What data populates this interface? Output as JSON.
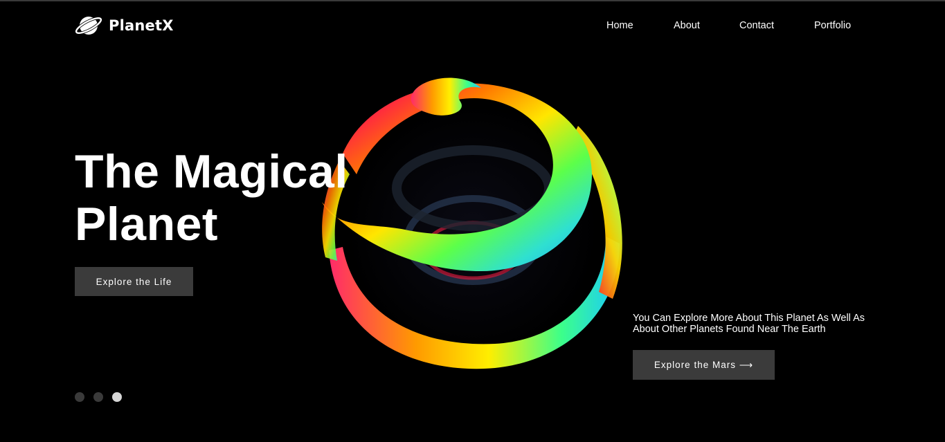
{
  "brand": {
    "name": "PlanetX",
    "logo_icon": "planet-ring-icon"
  },
  "nav": {
    "items": [
      {
        "label": "Home"
      },
      {
        "label": "About"
      },
      {
        "label": "Contact"
      },
      {
        "label": "Portfolio"
      }
    ]
  },
  "hero": {
    "title_line1": "The Magical",
    "title_line2": "Planet",
    "primary_button": "Explore the Life",
    "side_text": "You Can Explore More About This Planet As Well As About Other Planets Found Near The Earth",
    "secondary_button": "Explore the Mars ⟶",
    "art_icon": "rainbow-spiral-planet-image"
  },
  "slider": {
    "total": 3,
    "active_index": 3
  },
  "colors": {
    "background": "#000000",
    "button": "#3b3b3b",
    "dot_inactive": "#3a3a3a",
    "dot_active": "#d6d6d6"
  }
}
